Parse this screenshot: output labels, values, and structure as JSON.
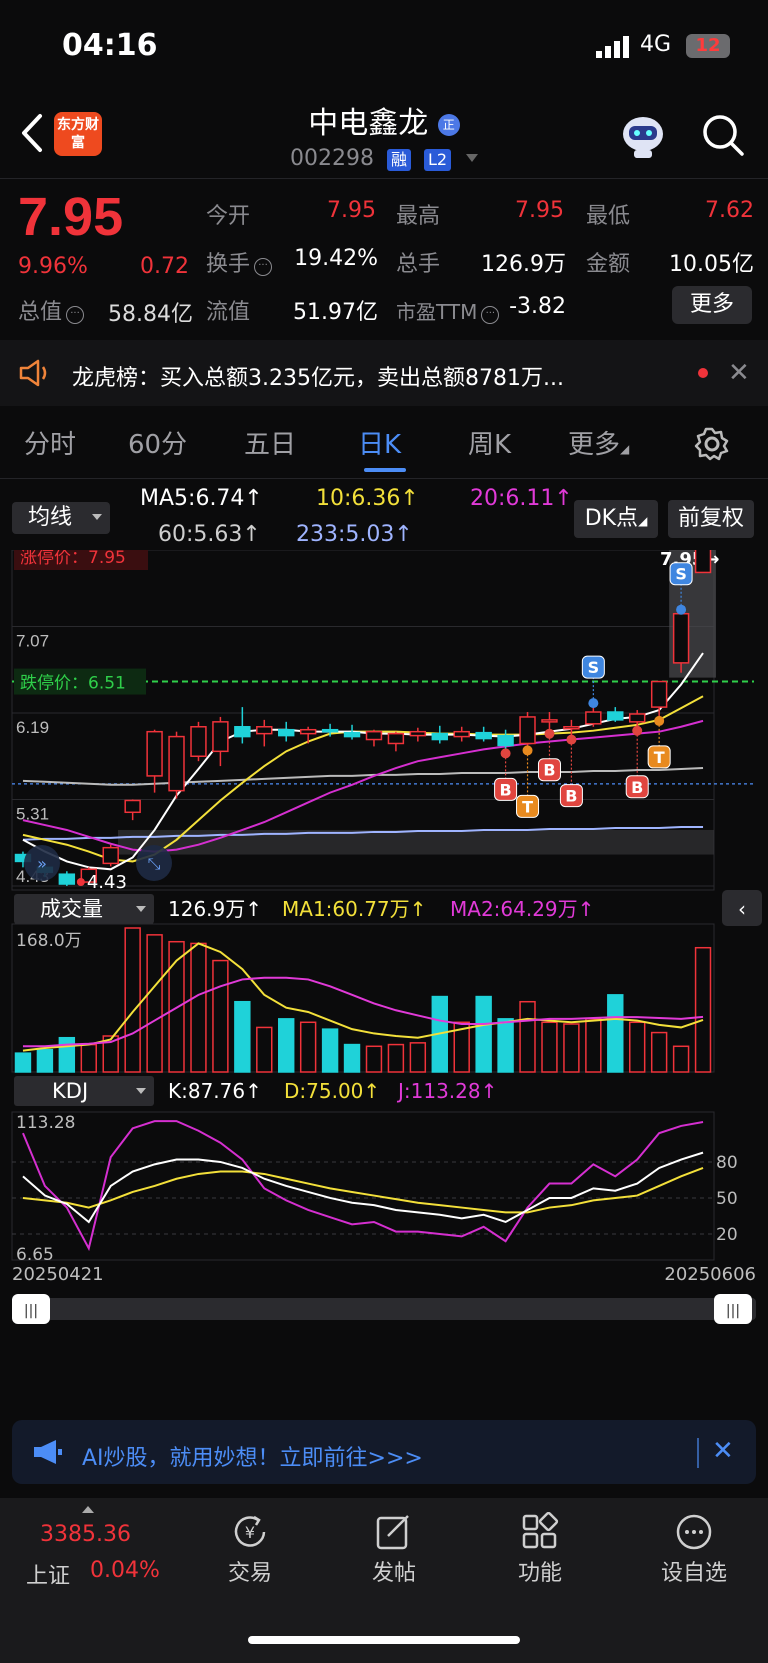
{
  "status": {
    "time": "04:16",
    "network": "4G",
    "battery": "12"
  },
  "header": {
    "logo": "东方财富",
    "name": "中电鑫龙",
    "code": "002298",
    "tags": [
      "融",
      "L2"
    ]
  },
  "quote": {
    "price": "7.95",
    "pct": "9.96%",
    "change": "0.72",
    "fields": [
      {
        "label": "今开",
        "value": "7.95",
        "color": "red"
      },
      {
        "label": "最高",
        "value": "7.95",
        "color": "red"
      },
      {
        "label": "最低",
        "value": "7.62",
        "color": "red"
      },
      {
        "label": "换手",
        "value": "19.42%",
        "color": "white"
      },
      {
        "label": "总手",
        "value": "126.9万",
        "color": "white"
      },
      {
        "label": "金额",
        "value": "10.05亿",
        "color": "white"
      },
      {
        "label": "流值",
        "value": "51.97亿",
        "color": "white"
      },
      {
        "label": "市盈TTM",
        "value": "-3.82",
        "color": "white"
      }
    ],
    "mktcap_label": "总值",
    "mktcap_value": "58.84亿",
    "more": "更多"
  },
  "notice": {
    "text": "龙虎榜：买入总额3.235亿元，卖出总额8781万..."
  },
  "tabs": [
    "分时",
    "60分",
    "五日",
    "日K",
    "周K",
    "更多"
  ],
  "active_tab": "日K",
  "ma_legend": {
    "selector": "均线",
    "ma5": "MA5:6.74↑",
    "ma10": "10:6.36↑",
    "ma20": "20:6.11↑",
    "ma60": "60:5.63↑",
    "ma233": "233:5.03↑",
    "dk": "DK点",
    "fq": "前复权"
  },
  "chart_data": {
    "type": "candlestick",
    "y_ticks": [
      "7.95",
      "7.07",
      "6.19",
      "5.31",
      "4.43"
    ],
    "ylim": [
      4.43,
      7.95
    ],
    "limit_up_label": "涨停价：7.95",
    "limit_down_label": "跌停价：6.51",
    "last_price_label": "7.95→",
    "low_label": "4.43",
    "candles": [
      {
        "o": 4.75,
        "h": 4.78,
        "l": 4.62,
        "c": 4.68
      },
      {
        "o": 4.62,
        "h": 4.66,
        "l": 4.52,
        "c": 4.57
      },
      {
        "o": 4.55,
        "h": 4.58,
        "l": 4.43,
        "c": 4.45
      },
      {
        "o": 4.47,
        "h": 4.62,
        "l": 4.45,
        "c": 4.6
      },
      {
        "o": 4.66,
        "h": 4.85,
        "l": 4.63,
        "c": 4.82
      },
      {
        "o": 5.18,
        "h": 5.31,
        "l": 5.1,
        "c": 5.3
      },
      {
        "o": 5.55,
        "h": 6.02,
        "l": 5.38,
        "c": 6.0
      },
      {
        "o": 5.4,
        "h": 6.0,
        "l": 5.32,
        "c": 5.95
      },
      {
        "o": 5.75,
        "h": 6.1,
        "l": 5.7,
        "c": 6.05
      },
      {
        "o": 5.8,
        "h": 6.15,
        "l": 5.65,
        "c": 6.1
      },
      {
        "o": 6.05,
        "h": 6.25,
        "l": 5.88,
        "c": 5.95
      },
      {
        "o": 5.98,
        "h": 6.12,
        "l": 5.85,
        "c": 6.05
      },
      {
        "o": 6.02,
        "h": 6.1,
        "l": 5.9,
        "c": 5.96
      },
      {
        "o": 5.98,
        "h": 6.05,
        "l": 5.88,
        "c": 6.02
      },
      {
        "o": 6.02,
        "h": 6.08,
        "l": 5.95,
        "c": 6.0
      },
      {
        "o": 5.99,
        "h": 6.07,
        "l": 5.92,
        "c": 5.95
      },
      {
        "o": 5.92,
        "h": 6.02,
        "l": 5.85,
        "c": 6.0
      },
      {
        "o": 5.88,
        "h": 6.0,
        "l": 5.8,
        "c": 5.98
      },
      {
        "o": 5.96,
        "h": 6.04,
        "l": 5.9,
        "c": 6.0
      },
      {
        "o": 5.98,
        "h": 6.06,
        "l": 5.88,
        "c": 5.92
      },
      {
        "o": 5.95,
        "h": 6.05,
        "l": 5.9,
        "c": 6.0
      },
      {
        "o": 5.99,
        "h": 6.05,
        "l": 5.9,
        "c": 5.93
      },
      {
        "o": 5.96,
        "h": 6.02,
        "l": 5.82,
        "c": 5.86
      },
      {
        "o": 5.88,
        "h": 6.2,
        "l": 5.85,
        "c": 6.15
      },
      {
        "o": 6.1,
        "h": 6.2,
        "l": 6.02,
        "c": 6.12
      },
      {
        "o": 6.05,
        "h": 6.12,
        "l": 5.96,
        "c": 6.05
      },
      {
        "o": 6.08,
        "h": 6.25,
        "l": 6.05,
        "c": 6.2
      },
      {
        "o": 6.2,
        "h": 6.25,
        "l": 6.1,
        "c": 6.12
      },
      {
        "o": 6.1,
        "h": 6.22,
        "l": 6.05,
        "c": 6.18
      },
      {
        "o": 6.25,
        "h": 6.5,
        "l": 6.15,
        "c": 6.51
      },
      {
        "o": 6.7,
        "h": 7.2,
        "l": 6.6,
        "c": 7.2
      },
      {
        "o": 7.62,
        "h": 7.95,
        "l": 7.62,
        "c": 7.95
      }
    ],
    "ma5": [
      4.9,
      4.78,
      4.68,
      4.62,
      4.6,
      4.72,
      5.0,
      5.35,
      5.62,
      5.9,
      6.0,
      6.02,
      6.02,
      6.0,
      6.0,
      6.0,
      5.98,
      5.98,
      5.97,
      5.97,
      5.97,
      5.96,
      5.95,
      5.97,
      6.0,
      6.03,
      6.08,
      6.13,
      6.15,
      6.22,
      6.48,
      6.8
    ],
    "ma10": [
      4.95,
      4.9,
      4.85,
      4.78,
      4.7,
      4.68,
      4.75,
      4.9,
      5.1,
      5.3,
      5.48,
      5.65,
      5.8,
      5.9,
      5.98,
      6.0,
      6.0,
      6.0,
      5.99,
      5.98,
      5.98,
      5.97,
      5.97,
      5.97,
      5.98,
      5.99,
      6.01,
      6.04,
      6.07,
      6.12,
      6.24,
      6.36
    ],
    "ma20": [
      5.1,
      5.05,
      5.0,
      4.93,
      4.86,
      4.8,
      4.78,
      4.8,
      4.85,
      4.92,
      5.0,
      5.08,
      5.18,
      5.28,
      5.38,
      5.46,
      5.55,
      5.63,
      5.7,
      5.74,
      5.78,
      5.82,
      5.85,
      5.88,
      5.9,
      5.92,
      5.94,
      5.96,
      5.98,
      6.0,
      6.05,
      6.11
    ],
    "ma60": [
      5.5,
      5.49,
      5.48,
      5.47,
      5.46,
      5.46,
      5.47,
      5.48,
      5.49,
      5.5,
      5.51,
      5.52,
      5.53,
      5.54,
      5.55,
      5.55,
      5.56,
      5.56,
      5.57,
      5.57,
      5.58,
      5.58,
      5.58,
      5.59,
      5.59,
      5.59,
      5.6,
      5.6,
      5.61,
      5.61,
      5.62,
      5.63
    ],
    "ma233": [
      4.9,
      4.91,
      4.91,
      4.92,
      4.92,
      4.93,
      4.93,
      4.94,
      4.94,
      4.95,
      4.95,
      4.96,
      4.96,
      4.97,
      4.97,
      4.97,
      4.98,
      4.98,
      4.99,
      4.99,
      4.99,
      5.0,
      5.0,
      5.0,
      5.01,
      5.01,
      5.01,
      5.02,
      5.02,
      5.02,
      5.03,
      5.03
    ],
    "signals": [
      {
        "i": 22,
        "type": "B"
      },
      {
        "i": 23,
        "type": "T"
      },
      {
        "i": 24,
        "type": "B"
      },
      {
        "i": 25,
        "type": "B"
      },
      {
        "i": 26,
        "type": "S"
      },
      {
        "i": 28,
        "type": "B"
      },
      {
        "i": 29,
        "type": "T"
      },
      {
        "i": 30,
        "type": "S"
      }
    ],
    "volume": {
      "selector": "成交量",
      "current": "126.9万↑",
      "ma1": "MA1:60.77万↑",
      "ma2": "MA2:64.29万↑",
      "max_label": "168.0万",
      "max": 168,
      "values": [
        22,
        26,
        40,
        32,
        42,
        168,
        160,
        152,
        150,
        130,
        82,
        52,
        62,
        58,
        50,
        32,
        30,
        32,
        34,
        88,
        58,
        88,
        62,
        82,
        58,
        56,
        62,
        90,
        58,
        46,
        30,
        145
      ],
      "ma1_values": [
        25,
        28,
        30,
        32,
        38,
        70,
        100,
        130,
        150,
        140,
        120,
        90,
        75,
        70,
        60,
        50,
        45,
        42,
        40,
        45,
        50,
        55,
        58,
        62,
        60,
        58,
        60,
        62,
        60,
        55,
        52,
        60.77
      ],
      "ma2_values": [
        30,
        30,
        32,
        33,
        35,
        45,
        60,
        75,
        90,
        100,
        108,
        110,
        110,
        108,
        100,
        90,
        80,
        72,
        66,
        60,
        56,
        56,
        58,
        60,
        62,
        62,
        63,
        64,
        64,
        63,
        62,
        64.29
      ]
    },
    "kdj": {
      "selector": "KDJ",
      "k": "K:87.76↑",
      "d": "D:75.00↑",
      "j": "J:113.28↑",
      "max_label": "113.28",
      "min_label": "6.65",
      "levels": [
        "80",
        "50",
        "20"
      ],
      "k_values": [
        68,
        52,
        45,
        30,
        60,
        72,
        78,
        82,
        82,
        80,
        75,
        66,
        60,
        55,
        50,
        46,
        44,
        40,
        38,
        36,
        33,
        36,
        30,
        40,
        50,
        50,
        58,
        56,
        62,
        75,
        82,
        87.76
      ],
      "d_values": [
        50,
        48,
        46,
        42,
        48,
        55,
        60,
        66,
        70,
        72,
        72,
        70,
        66,
        62,
        58,
        55,
        52,
        49,
        46,
        44,
        42,
        40,
        38,
        38,
        42,
        44,
        48,
        50,
        52,
        60,
        68,
        75
      ],
      "j_values": [
        104,
        60,
        42,
        8,
        84,
        108,
        114,
        114,
        106,
        96,
        82,
        58,
        48,
        40,
        34,
        28,
        30,
        22,
        22,
        20,
        18,
        26,
        14,
        42,
        62,
        62,
        78,
        68,
        82,
        104,
        110,
        113.28
      ]
    },
    "x_start": "20250421",
    "x_end": "20250606"
  },
  "ai_banner": {
    "text": "AI炒股，就用妙想！立即前往>>>"
  },
  "bottom_nav": {
    "index_value": "3385.36",
    "index_name": "上证",
    "index_pct": "0.04%",
    "items": [
      "交易",
      "发帖",
      "功能",
      "设自选"
    ]
  },
  "colors": {
    "up": "#f0333a",
    "down": "#1fd2d9",
    "ma5": "#ffffff",
    "ma10": "#f3e03a",
    "ma20": "#d52fd0",
    "ma60": "#bbbbbb",
    "ma233": "#9fb4ff",
    "accent": "#4c8df6"
  }
}
